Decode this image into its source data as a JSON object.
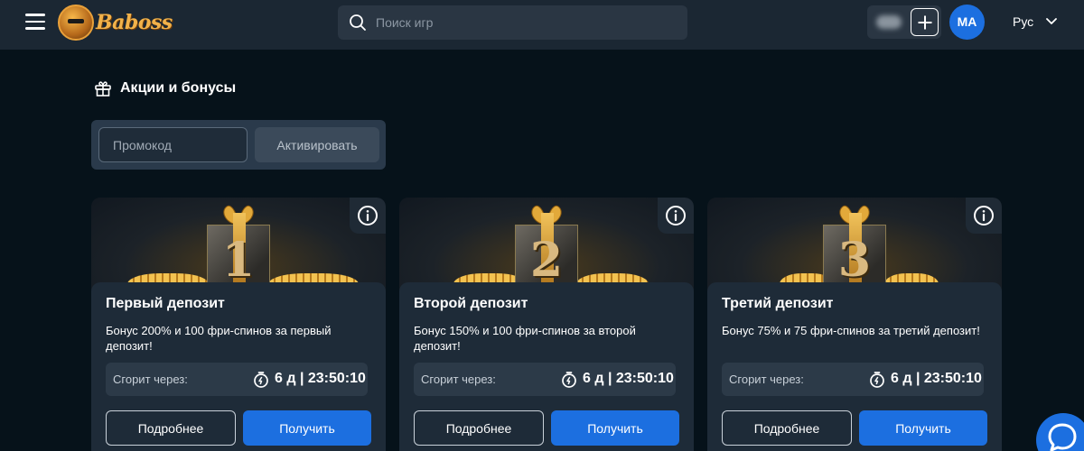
{
  "header": {
    "logo_text": "Baboss",
    "search": {
      "placeholder": "Поиск игр"
    },
    "avatar_initials": "MA",
    "language": "Рус"
  },
  "promotions": {
    "title": "Акции и бонусы",
    "promo_placeholder": "Промокод",
    "activate_label": "Активировать"
  },
  "cards": [
    {
      "number": "1",
      "title": "Первый депозит",
      "description": "Бонус 200% и 100 фри-спинов за первый депозит!",
      "expires_label": "Сгорит через:",
      "expires_value": "6 д | 23:50:10",
      "more_label": "Подробнее",
      "get_label": "Получить"
    },
    {
      "number": "2",
      "title": "Второй депозит",
      "description": "Бонус 150% и 100 фри-спинов за второй депозит!",
      "expires_label": "Сгорит через:",
      "expires_value": "6 д | 23:50:10",
      "more_label": "Подробнее",
      "get_label": "Получить"
    },
    {
      "number": "3",
      "title": "Третий депозит",
      "description": "Бонус 75% и 75 фри-спинов за третий депозит!",
      "expires_label": "Сгорит через:",
      "expires_value": "6 д | 23:50:10",
      "more_label": "Подробнее",
      "get_label": "Получить"
    }
  ],
  "colors": {
    "background": "#06121a",
    "header": "#1b2733",
    "card": "#1e2b38",
    "accent": "#1c6fe0",
    "logo": "#f2b24a"
  },
  "icons": [
    "menu-icon",
    "search-icon",
    "gift-icon",
    "info-icon",
    "timer-icon",
    "chevron-down-icon",
    "chat-icon"
  ]
}
